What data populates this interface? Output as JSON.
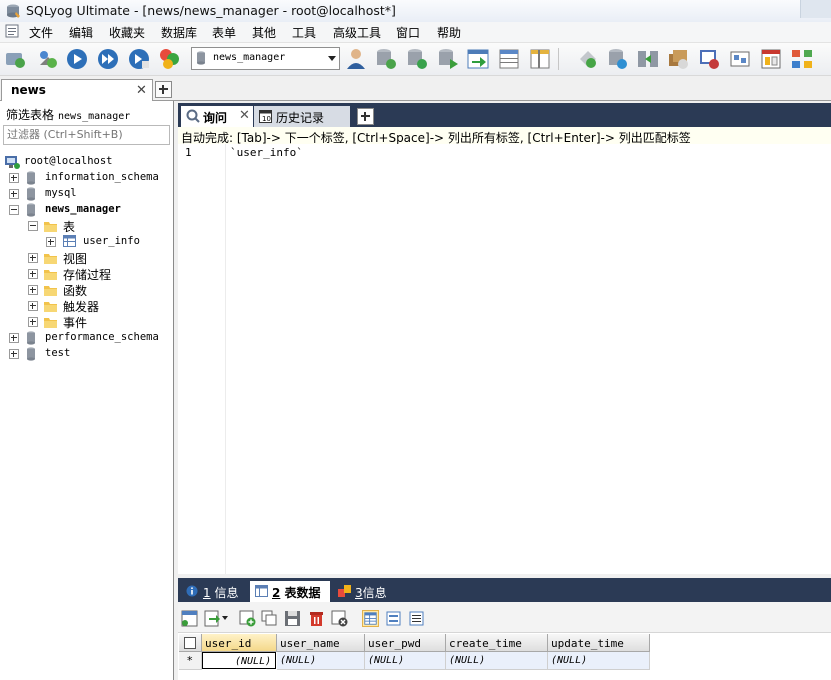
{
  "window": {
    "title": "SQLyog Ultimate - [news/news_manager - root@localhost*]"
  },
  "menu": [
    "文件",
    "编辑",
    "收藏夹",
    "数据库",
    "表单",
    "其他",
    "工具",
    "高级工具",
    "窗口",
    "帮助"
  ],
  "toolbar": {
    "database_select": "news_manager"
  },
  "connection_tab": {
    "label": "news"
  },
  "object_browser": {
    "filter_label": "筛选表格",
    "filter_db": "news_manager",
    "filter_placeholder": "过滤器 (Ctrl+Shift+B)",
    "root": "root@localhost",
    "databases": [
      "information_schema",
      "mysql",
      "news_manager",
      "performance_schema",
      "test"
    ],
    "news_manager_children": {
      "tables_folder": "表",
      "table": "user_info",
      "folders": [
        "视图",
        "存储过程",
        "函数",
        "触发器",
        "事件"
      ]
    }
  },
  "query_tabs": [
    {
      "label": "询问"
    },
    {
      "label": "历史记录"
    }
  ],
  "editor": {
    "autocomplete_hint": "自动完成: [Tab]-> 下一个标签, [Ctrl+Space]-> 列出所有标签, [Ctrl+Enter]-> 列出匹配标签",
    "line_number": "1",
    "code": "`user_info`"
  },
  "result_tabs": [
    {
      "num": "1",
      "label": "信息"
    },
    {
      "num": "2",
      "label": "表数据"
    },
    {
      "num": "3",
      "label": "信息"
    }
  ],
  "grid": {
    "columns": [
      "user_id",
      "user_name",
      "user_pwd",
      "create_time",
      "update_time"
    ],
    "row_marker": "*",
    "row": [
      "(NULL)",
      "(NULL)",
      "(NULL)",
      "(NULL)",
      "(NULL)"
    ]
  }
}
